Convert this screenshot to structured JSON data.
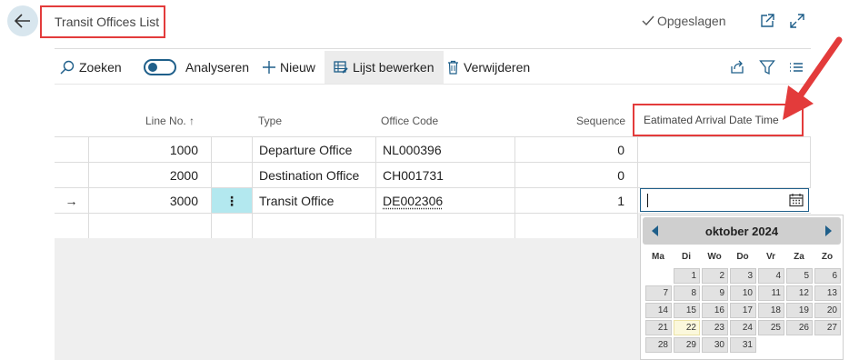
{
  "header": {
    "title": "Transit Offices List",
    "saved_label": "Opgeslagen",
    "icons": [
      "back-arrow-icon",
      "open-in-new-window-icon",
      "expand-icon"
    ]
  },
  "toolbar": {
    "search_label": "Zoeken",
    "analyze_label": "Analyseren",
    "new_label": "Nieuw",
    "edit_list_label": "Lijst bewerken",
    "delete_label": "Verwijderen",
    "right_icons": [
      "share-icon",
      "filter-icon",
      "list-view-icon"
    ]
  },
  "table": {
    "columns": {
      "line_no": "Line No. ↑",
      "type": "Type",
      "office_code": "Office Code",
      "sequence": "Sequence",
      "eta": "Eatimated Arrival Date Time"
    },
    "rows": [
      {
        "line_no": "1000",
        "type": "Departure Office",
        "office_code": "NL000396",
        "sequence": "0",
        "eta": ""
      },
      {
        "line_no": "2000",
        "type": "Destination Office",
        "office_code": "CH001731",
        "sequence": "0",
        "eta": ""
      },
      {
        "line_no": "3000",
        "type": "Transit Office",
        "office_code": "DE002306",
        "sequence": "1",
        "eta": ""
      }
    ],
    "current_row_indicator": "→",
    "row_menu_glyph": "⋮"
  },
  "calendar": {
    "month_label": "oktober 2024",
    "day_names": [
      "Ma",
      "Di",
      "Wo",
      "Do",
      "Vr",
      "Za",
      "Zo"
    ],
    "weeks": [
      [
        "",
        "1",
        "2",
        "3",
        "4",
        "5",
        "6"
      ],
      [
        "7",
        "8",
        "9",
        "10",
        "11",
        "12",
        "13"
      ],
      [
        "14",
        "15",
        "16",
        "17",
        "18",
        "19",
        "20"
      ],
      [
        "21",
        "22",
        "23",
        "24",
        "25",
        "26",
        "27"
      ],
      [
        "28",
        "29",
        "30",
        "31",
        "",
        "",
        ""
      ]
    ],
    "today": "22"
  },
  "colors": {
    "highlight_box": "#e33b3b",
    "accent": "#1f5f8a",
    "row_menu_bg": "#b3e8ef",
    "annotation_arrow": "#e33b3b"
  }
}
